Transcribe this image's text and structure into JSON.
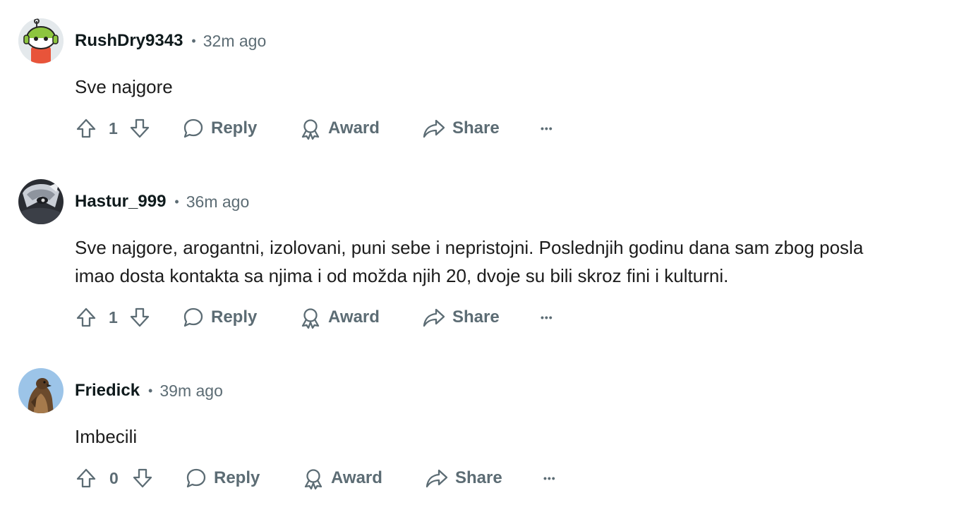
{
  "comments": [
    {
      "author": "RushDry9343",
      "separator": "•",
      "time": "32m ago",
      "lines": [
        "Sve najgore"
      ],
      "score": "1",
      "actions": {
        "reply": "Reply",
        "award": "Award",
        "share": "Share",
        "more": "•••"
      },
      "avatar": "green-headphones-robot-avatar"
    },
    {
      "author": "Hastur_999",
      "separator": "•",
      "time": "36m ago",
      "lines": [
        "Sve najgore, arogantni, izolovani, puni sebe i nepristojni. Poslednjih godinu dana sam zbog posla",
        "imao dosta kontakta sa njima i od možda njih 20, dvoje su bili skroz fini i kulturni."
      ],
      "score": "1",
      "actions": {
        "reply": "Reply",
        "award": "Award",
        "share": "Share",
        "more": "•••"
      },
      "avatar": "masked-warrior-avatar"
    },
    {
      "author": "Friedick",
      "separator": "•",
      "time": "39m ago",
      "lines": [
        "Imbecili"
      ],
      "score": "0",
      "actions": {
        "reply": "Reply",
        "award": "Award",
        "share": "Share",
        "more": "•••"
      },
      "avatar": "hawk-photo-avatar"
    }
  ],
  "colors": {
    "meta": "#5c6c74",
    "text": "#1c1c1c",
    "author": "#0f1a1c"
  }
}
